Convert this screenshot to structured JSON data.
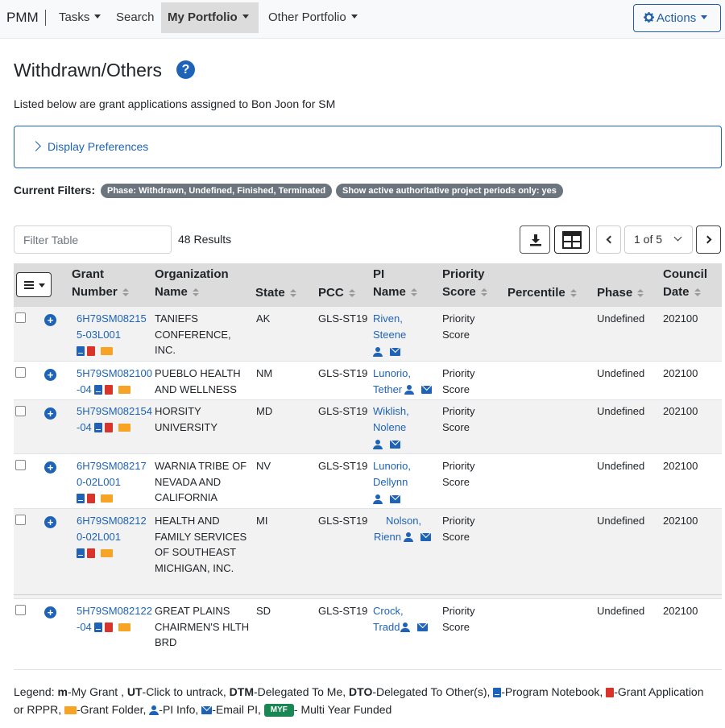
{
  "nav": {
    "brand": "PMM",
    "tasks": "Tasks",
    "search": "Search",
    "my_portfolio": "My Portfolio",
    "other_portfolio": "Other Portfolio",
    "actions": "Actions"
  },
  "page": {
    "title": "Withdrawn/Others",
    "help_icon": "question-circle-icon",
    "subtitle": "Listed below are grant applications assigned to Bon Joon for SM",
    "display_preferences": "Display Preferences"
  },
  "filters": {
    "label": "Current Filters:",
    "badges": [
      "Phase: Withdrawn, Undefined, Finished, Terminated",
      "Show active authoritative project periods only: yes"
    ]
  },
  "controls": {
    "filter_placeholder": "Filter Table",
    "results": "48 Results",
    "page_select": "1 of 5"
  },
  "table": {
    "headers": {
      "grant": [
        "Grant",
        "Number"
      ],
      "org": [
        "Organization",
        "Name"
      ],
      "state": "State",
      "pcc": "PCC",
      "pi": [
        "PI",
        "Name"
      ],
      "priority": [
        "Priority",
        "Score"
      ],
      "percentile": "Percentile",
      "phase": "Phase",
      "council": [
        "Council",
        "Date"
      ]
    },
    "rows": [
      {
        "grant": "6H79SM082155-03L001",
        "org": "TANIEFS CONFERENCE, INC.",
        "state": "AK",
        "pcc": "GLS-ST19",
        "pi": "Riven, Steene",
        "priority": "Priority Score",
        "phase": "Undefined",
        "council": "202100"
      },
      {
        "grant": "5H79SM082100-04",
        "org": "PUEBLO HEALTH AND WELLNESS",
        "state": "NM",
        "pcc": "GLS-ST19",
        "pi": "Lunorio, Tether",
        "priority": "Priority Score",
        "phase": "Undefined",
        "council": "202100"
      },
      {
        "grant": "5H79SM082154-04",
        "org": "HORSITY UNIVERSITY",
        "state": "MD",
        "pcc": "GLS-ST19",
        "pi": "Wiklish, Nolene",
        "priority": "Priority Score",
        "phase": "Undefined",
        "council": "202100"
      },
      {
        "grant": "6H79SM082170-02L001",
        "org": "WARNIA TRIBE OF NEVADA AND CALIFORNIA",
        "state": "NV",
        "pcc": "GLS-ST19",
        "pi": "Lunorio, Dellynn",
        "priority": "Priority Score",
        "phase": "Undefined",
        "council": "202100"
      },
      {
        "grant": "6H79SM082120-02L001",
        "org": "HEALTH AND FAMILY SERVICES OF SOUTHEAST MICHIGAN, INC.",
        "state": "MI",
        "pcc": "GLS-ST19",
        "pi": "Nolson, Rienn",
        "priority": "Priority Score",
        "phase": "Undefined",
        "council": "202100"
      },
      {
        "grant": "5H79SM082122-04",
        "org": "GREAT PLAINS CHAIRMEN'S HLTH BRD",
        "state": "SD",
        "pcc": "GLS-ST19",
        "pi": "Crock, Tradd",
        "priority": "Priority Score",
        "phase": "Undefined",
        "council": "202100"
      }
    ]
  },
  "legend": {
    "prefix": "Legend:",
    "m": "m",
    "m_text": "-My Grant ,",
    "ut": "UT",
    "ut_text": "-Click to untrack,",
    "dtm": "DTM",
    "dtm_text": "-Delegated To Me,",
    "dto": "DTO",
    "dto_text": "-Delegated To Other(s),",
    "notebook_text": "-Program Notebook,",
    "pdf_text": "-Grant Application or RPPR,",
    "folder_text": "-Grant Folder,",
    "pi_text": "-PI Info,",
    "email_text": "-Email PI,",
    "myf": "MYF",
    "myf_text": "- Multi Year Funded"
  }
}
